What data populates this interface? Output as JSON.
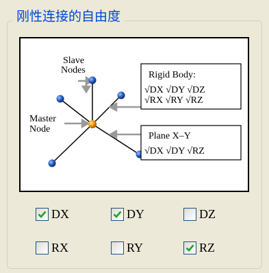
{
  "group": {
    "title": "刚性连接的自由度"
  },
  "diagram": {
    "slave_label_line1": "Slave",
    "slave_label_line2": "Nodes",
    "master_label_line1": "Master",
    "master_label_line2": "Node",
    "rigid_title": "Rigid Body:",
    "rigid_row1": "√DX √DY √DZ",
    "rigid_row2": "√RX √RY √RZ",
    "plane_title": "Plane X–Y",
    "plane_row": "√DX √DY √RZ"
  },
  "checkboxes": [
    {
      "label": "DX",
      "checked": true
    },
    {
      "label": "DY",
      "checked": true
    },
    {
      "label": "DZ",
      "checked": false
    },
    {
      "label": "RX",
      "checked": false
    },
    {
      "label": "RY",
      "checked": false
    },
    {
      "label": "RZ",
      "checked": true
    }
  ],
  "colors": {
    "check": "#21A121",
    "accent": "#0046D5",
    "master_node": "#F09A10",
    "slave_node": "#1F5BC4"
  }
}
